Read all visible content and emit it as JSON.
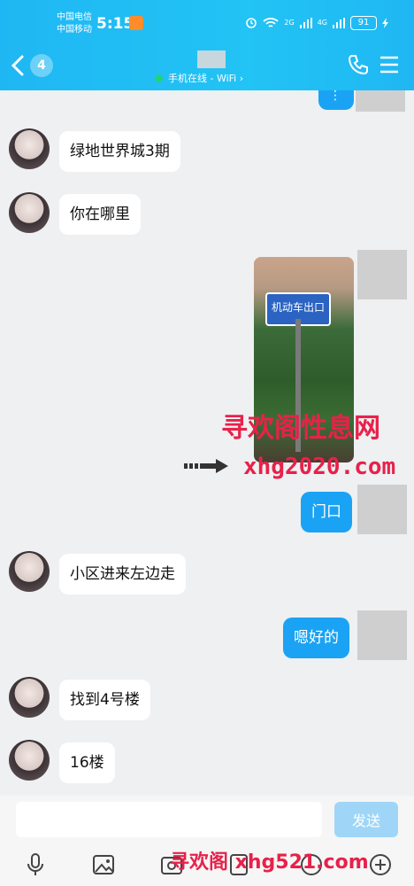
{
  "status_bar": {
    "carrier1": "中国电信",
    "carrier2": "中国移动",
    "time": "5:15",
    "battery": "91",
    "net1": "2G",
    "net2": "4G"
  },
  "header": {
    "unread_count": "4",
    "online_status": "手机在线 - WiFi ›"
  },
  "messages": [
    {
      "side": "in",
      "text": "绿地世界城3期"
    },
    {
      "side": "in",
      "text": "你在哪里"
    },
    {
      "side": "out",
      "type": "image",
      "sign_text": "机动车出口"
    },
    {
      "side": "out",
      "text": "门口"
    },
    {
      "side": "in",
      "text": "小区进来左边走"
    },
    {
      "side": "out",
      "text": "嗯好的"
    },
    {
      "side": "in",
      "text": "找到4号楼"
    },
    {
      "side": "in",
      "text": "16楼"
    }
  ],
  "watermarks": {
    "line1": "寻欢阁性息网",
    "line2": "xhg2020.com",
    "bottom": "寻欢阁 xhg521.com"
  },
  "input": {
    "value": "",
    "send_label": "发送"
  },
  "colors": {
    "header": "#1fb7f3",
    "out_bubble": "#1aa3f4",
    "send_disabled": "#9fd6f8",
    "watermark": "#e8214a"
  }
}
